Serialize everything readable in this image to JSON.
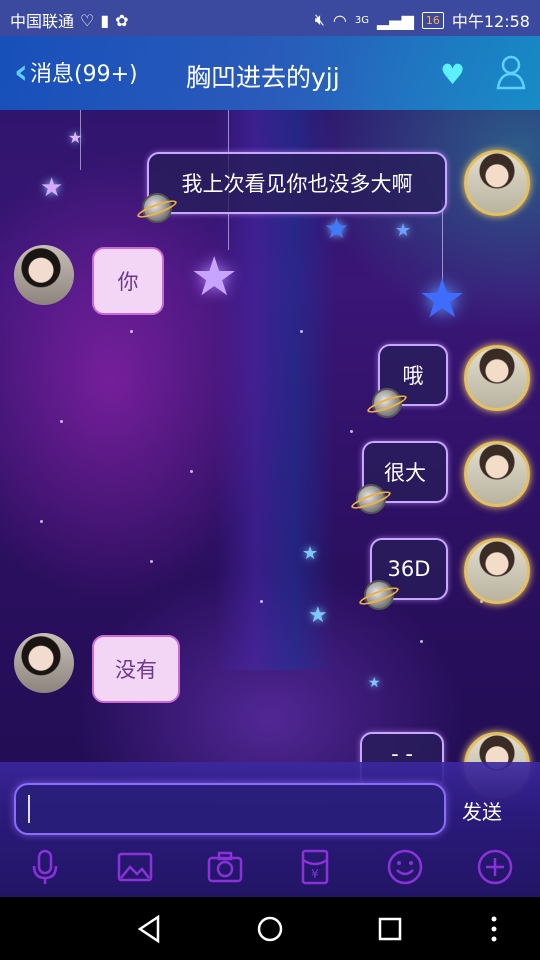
{
  "status_bar": {
    "carrier": "中国联通",
    "network": "3G",
    "battery": "16",
    "time": "中午12:58"
  },
  "header": {
    "back_label": "消息(99+)",
    "title": "胸凹进去的yjj",
    "icons": [
      "heart-icon",
      "profile-icon"
    ]
  },
  "messages": [
    {
      "side": "out",
      "text": "我上次看见你也没多大啊"
    },
    {
      "side": "in",
      "text": "你"
    },
    {
      "side": "out",
      "text": "哦"
    },
    {
      "side": "out",
      "text": "很大"
    },
    {
      "side": "out",
      "text": "36D"
    },
    {
      "side": "in",
      "text": "没有"
    },
    {
      "side": "out",
      "text": "- -"
    }
  ],
  "composer": {
    "input_value": "",
    "send_label": "发送",
    "tools": [
      "microphone-icon",
      "image-icon",
      "camera-icon",
      "red-packet-icon",
      "emoji-icon",
      "plus-icon"
    ]
  },
  "colors": {
    "header_accent": "#5fd0ff",
    "outgoing_bubble_border": "#c9a6ff",
    "incoming_bubble_bg": "#f3d6f6",
    "toolbar_icon": "#8a32d8"
  }
}
